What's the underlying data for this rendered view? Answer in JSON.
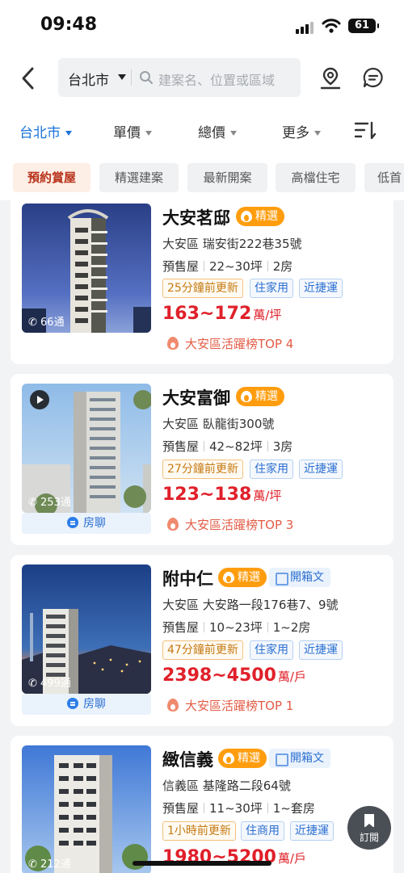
{
  "status": {
    "time": "09:48",
    "battery": "61"
  },
  "search": {
    "city": "台北市",
    "placeholder": "建案名、位置或區域"
  },
  "filters": [
    "台北市",
    "單價",
    "總價",
    "更多"
  ],
  "tags": [
    "預約賞屋",
    "精選建案",
    "最新開案",
    "高檔住宅",
    "低首"
  ],
  "listings": [
    {
      "title": "大安茗邸",
      "hot": "精選",
      "box": "",
      "address": "大安區  瑞安街222巷35號",
      "status": "預售屋",
      "size": "22~30坪",
      "rooms": "2房",
      "chips": [
        "25分鐘前更新",
        "住家用",
        "近捷運"
      ],
      "price": "163~172",
      "unit": "萬/坪",
      "rank": "大安區活躍榜TOP 4",
      "calls": "66通",
      "chat": "",
      "video": false
    },
    {
      "title": "大安富御",
      "hot": "精選",
      "box": "",
      "address": "大安區  臥龍街300號",
      "status": "預售屋",
      "size": "42~82坪",
      "rooms": "3房",
      "chips": [
        "27分鐘前更新",
        "住家用",
        "近捷運"
      ],
      "price": "123~138",
      "unit": "萬/坪",
      "rank": "大安區活躍榜TOP 3",
      "calls": "253通",
      "chat": "房聊",
      "video": true
    },
    {
      "title": "附中仁",
      "hot": "精選",
      "box": "開箱文",
      "address": "大安區  大安路一段176巷7、9號",
      "status": "預售屋",
      "size": "10~23坪",
      "rooms": "1~2房",
      "chips": [
        "47分鐘前更新",
        "住家用",
        "近捷運"
      ],
      "price": "2398~4500",
      "unit": "萬/戶",
      "rank": "大安區活躍榜TOP 1",
      "calls": "499通",
      "chat": "房聊",
      "video": false
    },
    {
      "title": "緻信義",
      "hot": "精選",
      "box": "開箱文",
      "address": "信義區  基隆路二段64號",
      "status": "預售屋",
      "size": "11~30坪",
      "rooms": "1~套房",
      "chips": [
        "1小時前更新",
        "住商用",
        "近捷運"
      ],
      "price": "1980~5200",
      "unit": "萬/戶",
      "rank": "",
      "calls": "212通",
      "chat": "",
      "video": false
    }
  ],
  "subscribe": "訂閱"
}
